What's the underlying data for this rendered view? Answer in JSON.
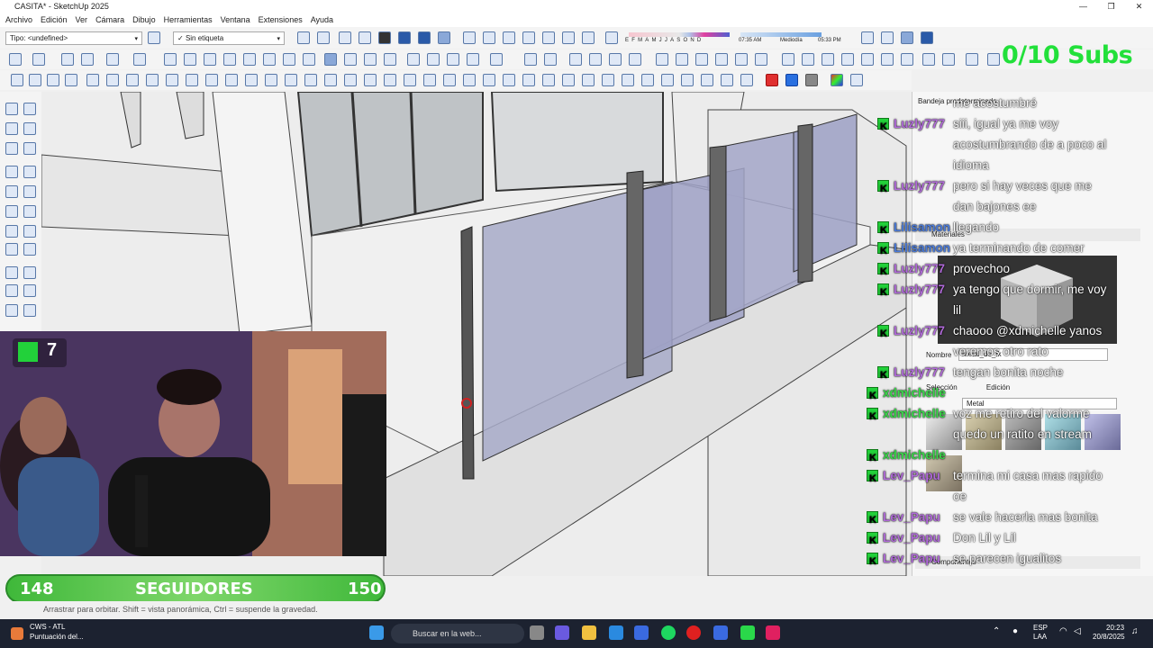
{
  "window": {
    "title": "CASITA* - SketchUp 2025",
    "controls": [
      "—",
      "❐",
      "✕"
    ]
  },
  "menu": [
    "Archivo",
    "Edición",
    "Ver",
    "Cámara",
    "Dibujo",
    "Herramientas",
    "Ventana",
    "Extensiones",
    "Ayuda"
  ],
  "toolbar": {
    "type_select": "Tipo: <undefined>",
    "tag_select": "Sin etiqueta",
    "months": "EFMAMJJASOND",
    "time_start": "07:35 AM",
    "time_mid": "Mediodía",
    "time_end": "05:33 PM"
  },
  "overlay": {
    "subs_counter": "0/10 Subs"
  },
  "tray": {
    "title": "Bandeja predeterminada",
    "materials_header": "Materiales",
    "material_name_label": "Nombre",
    "material_name": "Metal_de_fk",
    "tab_select": "Selección",
    "tab_edit": "Edición",
    "collection": "Metal",
    "components_header": "Componentes"
  },
  "status": {
    "hint": "Arrastrar para orbitar. Shift = vista panorámica, Ctrl = suspende la gravedad."
  },
  "taskbar": {
    "weather_line1": "CWS - ATL",
    "weather_line2": "Puntuación del...",
    "search_placeholder": "Buscar en la web...",
    "lang1": "ESP",
    "lang2": "LAA",
    "time": "20:23",
    "date": "20/8/2025"
  },
  "webcam": {
    "badge_count": "7"
  },
  "followers": {
    "current": "148",
    "label": "SEGUIDORES",
    "goal": "150"
  },
  "chat": [
    {
      "user": "",
      "text": "me acostumbré",
      "color": "#c9a6e8"
    },
    {
      "user": "Luzly777",
      "text": "siii, igual ya me voy",
      "color": "#b06ad8"
    },
    {
      "user": "",
      "text": "acostumbrando de a poco al",
      "color": "#b06ad8"
    },
    {
      "user": "",
      "text": "idioma",
      "color": "#b06ad8"
    },
    {
      "user": "Luzly777",
      "text": "pero si hay veces que me",
      "color": "#b06ad8"
    },
    {
      "user": "",
      "text": "dan bajones ee",
      "color": "#b06ad8"
    },
    {
      "user": "Lilisamon",
      "text": "llegando",
      "color": "#4a7ad8"
    },
    {
      "user": "Lilisamon",
      "text": "ya terminando de comer",
      "color": "#4a7ad8"
    },
    {
      "user": "Luzly777",
      "text": "provechoo",
      "color": "#b06ad8"
    },
    {
      "user": "Luzly777",
      "text": "ya tengo que dormir, me voy",
      "color": "#b06ad8"
    },
    {
      "user": "",
      "text": "lil",
      "color": "#b06ad8"
    },
    {
      "user": "Luzly777",
      "text": "chaooo @xdmichelle yanos",
      "color": "#b06ad8"
    },
    {
      "user": "",
      "text": "veremos otro rato",
      "color": "#b06ad8"
    },
    {
      "user": "Luzly777",
      "text": "tengan bonita noche",
      "color": "#b06ad8"
    },
    {
      "user": "xdmichelle",
      "text": "",
      "color": "#3ad84a"
    },
    {
      "user": "xdmichelle",
      "text": "voz me retiro del valorme",
      "color": "#3ad84a"
    },
    {
      "user": "",
      "text": "quedo un ratito en stream",
      "color": "#3ad84a"
    },
    {
      "user": "xdmichelle",
      "text": "",
      "color": "#3ad84a"
    },
    {
      "user": "Lev_Papu",
      "text": "termina mi casa mas rapido",
      "color": "#b06ad8"
    },
    {
      "user": "",
      "text": "oe",
      "color": "#b06ad8"
    },
    {
      "user": "Lev_Papu",
      "text": "se vale hacerla mas bonita",
      "color": "#b06ad8"
    },
    {
      "user": "Lev_Papu",
      "text": "Don Lil y Lil",
      "color": "#b06ad8"
    },
    {
      "user": "Lev_Papu",
      "text": "se parecen igualitos",
      "color": "#b06ad8"
    }
  ]
}
